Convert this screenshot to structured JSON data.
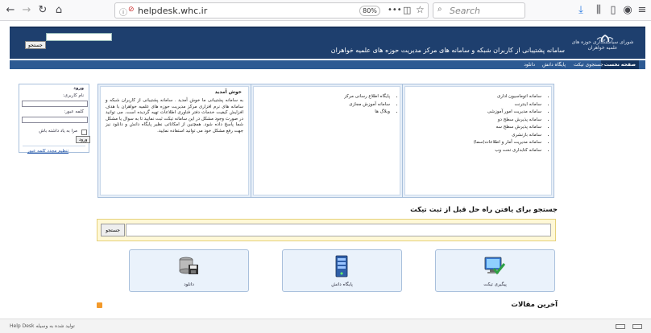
{
  "browser": {
    "url": "helpdesk.whc.ir",
    "zoom": "80%",
    "search_placeholder": "Search",
    "dots": "•••"
  },
  "header": {
    "title": "سامانه پشتیبانی از کاربران شبکه و سامانه های مرکز مدیریت حوزه های علمیه خواهران",
    "subtitle": "شورای سیاستگذاری حوزه های علمیه خواهران",
    "search_button": "جستجو"
  },
  "nav": {
    "items": [
      "صفحه نخست",
      "جستجوی تیکت",
      "پایگاه دانش",
      "دانلود"
    ]
  },
  "services": {
    "items": [
      "سامانه اتوماسیون اداری",
      "سامانه اینترنت",
      "سامانه مدیریت امور آموزشی",
      "سامانه پذیرش سطح دو",
      "سامانه پذیرش سطح سه",
      "سامانه بازنشری",
      "سامانه مدیریت آمار و اطلاعات(سما)",
      "سامانه کتابداری تحت وب"
    ]
  },
  "links": {
    "items": [
      "پایگاه اطلاع رسانی مرکز",
      "سامانه آموزش مجازی",
      "وبلاگ ها"
    ]
  },
  "welcome": {
    "title": "خوش آمدید",
    "text": "به سامانه پشتیبانی ما خوش آمدید . سامانه پشتیبانی از کاربران شبکه و سامانه های نرم افزاری مرکز مدیریت حوزه های علمیه خواهران با هدف افزایش کیفیت خدمات دفتر فناوری اطلاعات تهیه گردیده است. می توانید در صورت وجود مشکل در این سامانه تیکت ثبت نمایید تا به سوال یا مشکل شما پاسخ داده شود. همچنین از امکاناتی نظیر پایگاه دانش و دانلود نیز جهت رفع مشکل خود می توانید استفاده نمایید."
  },
  "login": {
    "heading": "ورود",
    "username_label": "نام کاربری:",
    "password_label": "کلمه عبور:",
    "remember_label": "مرا به یاد داشته باش",
    "login_button": "ورود",
    "forgot_link": "تنظیم مجدد کلمه عبور"
  },
  "ticket_search": {
    "heading": "جستجو برای یافتن راه حل قبل از ثبت تیکت",
    "button": "جستجو"
  },
  "tiles": [
    {
      "label": "پیگیری تیکت"
    },
    {
      "label": "پایگاه دانش"
    },
    {
      "label": "دانلود"
    }
  ],
  "articles": {
    "heading": "آخرین مقالات"
  },
  "footer": {
    "text": "Help Desk توليد شده به وسيله"
  }
}
